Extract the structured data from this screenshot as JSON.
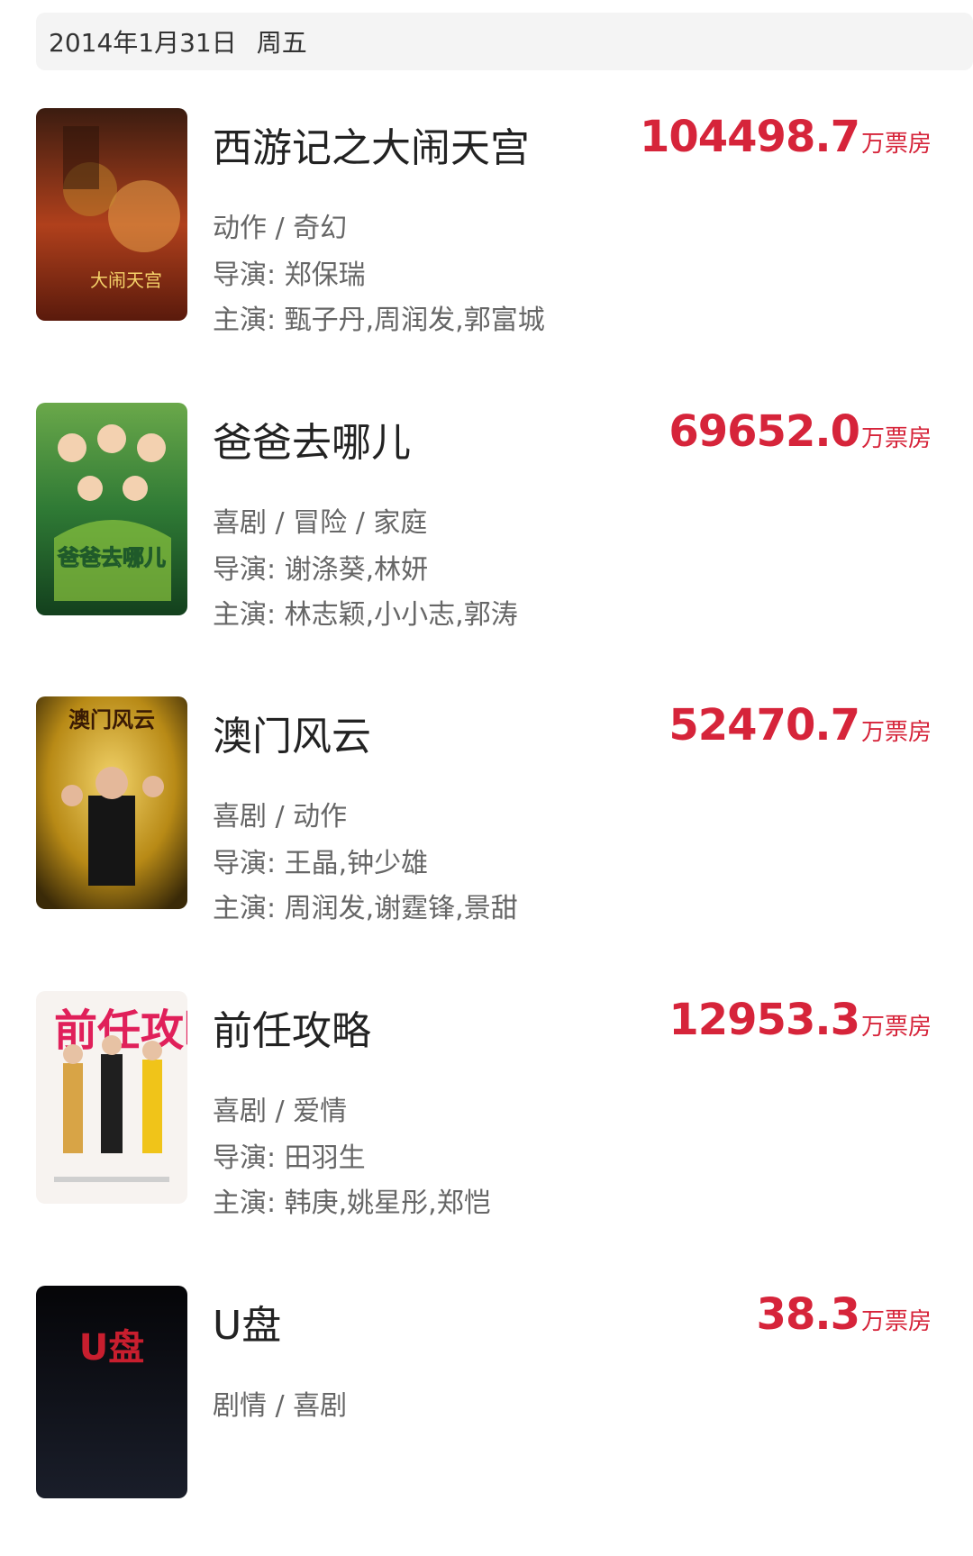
{
  "header": {
    "date": "2014年1月31日",
    "weekday": "周五"
  },
  "box_unit": "万票房",
  "movies": [
    {
      "title": "西游记之大闹天宫",
      "box_office": "104498.7",
      "genre": "动作 / 奇幻",
      "director": "导演: 郑保瑞",
      "cast": "主演: 甄子丹,周润发,郭富城",
      "poster_text": "大闹天宫",
      "poster_colors": [
        "#3b1c10",
        "#b0401c",
        "#e7a24a"
      ]
    },
    {
      "title": "爸爸去哪儿",
      "box_office": "69652.0",
      "genre": "喜剧 / 冒险 / 家庭",
      "director": "导演: 谢涤葵,林妍",
      "cast": "主演: 林志颖,小小志,郭涛",
      "poster_text": "爸爸去哪儿",
      "poster_colors": [
        "#1f5a2a",
        "#4f9a3a",
        "#cfe39a"
      ]
    },
    {
      "title": "澳门风云",
      "box_office": "52470.7",
      "genre": "喜剧 / 动作",
      "director": "导演: 王晶,钟少雄",
      "cast": "主演: 周润发,谢霆锋,景甜",
      "poster_text": "澳门风云",
      "poster_colors": [
        "#3a2a08",
        "#b88a16",
        "#f2d36a"
      ]
    },
    {
      "title": "前任攻略",
      "box_office": "12953.3",
      "genre": "喜剧 / 爱情",
      "director": "导演: 田羽生",
      "cast": "主演: 韩庚,姚星彤,郑恺",
      "poster_text": "前任攻略",
      "poster_colors": [
        "#ffffff",
        "#f4f0ee",
        "#e0205a"
      ]
    },
    {
      "title": "U盘",
      "box_office": "38.3",
      "genre": "剧情 / 喜剧",
      "director": "",
      "cast": "",
      "poster_text": "U盘",
      "poster_colors": [
        "#050508",
        "#1a1e2a",
        "#c81e2e"
      ]
    }
  ]
}
